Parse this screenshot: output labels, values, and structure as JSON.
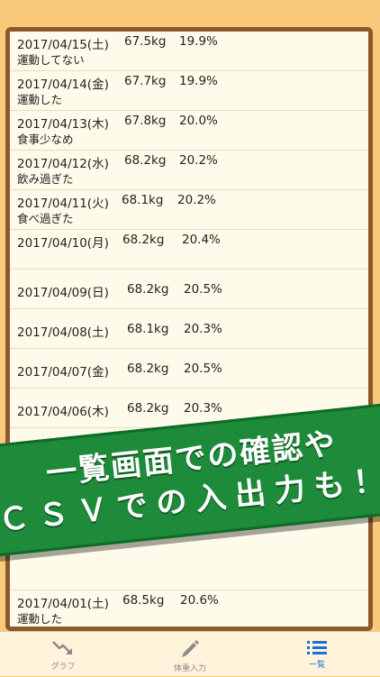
{
  "entries": [
    {
      "date": "2017/04/15(土)",
      "weight": "67.5kg",
      "fat": "19.9%",
      "memo": "運動してない"
    },
    {
      "date": "2017/04/14(金)",
      "weight": "67.7kg",
      "fat": "19.9%",
      "memo": "運動した"
    },
    {
      "date": "2017/04/13(木)",
      "weight": "67.8kg",
      "fat": "20.0%",
      "memo": "食事少なめ"
    },
    {
      "date": "2017/04/12(水)",
      "weight": "68.2kg",
      "fat": "20.2%",
      "memo": "飲み過ぎた"
    },
    {
      "date": "2017/04/11(火)",
      "weight": "68.1kg",
      "fat": "20.2%",
      "memo": "食べ過ぎた"
    },
    {
      "date": "2017/04/10(月)",
      "weight": "68.2kg",
      "fat": "20.4%",
      "memo": ""
    },
    {
      "date": "2017/04/09(日)",
      "weight": "68.2kg",
      "fat": "20.5%",
      "memo": ""
    },
    {
      "date": "2017/04/08(土)",
      "weight": "68.1kg",
      "fat": "20.3%",
      "memo": ""
    },
    {
      "date": "2017/04/07(金)",
      "weight": "68.2kg",
      "fat": "20.5%",
      "memo": ""
    },
    {
      "date": "2017/04/06(木)",
      "weight": "68.2kg",
      "fat": "20.3%",
      "memo": ""
    },
    {
      "date": "2017/04/01(土)",
      "weight": "68.5kg",
      "fat": "20.6%",
      "memo": "運動した"
    }
  ],
  "banner": {
    "line1": "一覧画面での確認や",
    "line2": "ＣＳＶでの入出力も！"
  },
  "tabs": [
    {
      "label": "グラフ",
      "icon": "graph-trend-icon",
      "active": false
    },
    {
      "label": "体重入力",
      "icon": "pencil-icon",
      "active": false
    },
    {
      "label": "一覧",
      "icon": "list-icon",
      "active": true
    }
  ],
  "colors": {
    "background": "#f8c97a",
    "frame": "#8b5a2b",
    "banner": "#1d8b3a",
    "active_tab": "#1a6fd6"
  }
}
